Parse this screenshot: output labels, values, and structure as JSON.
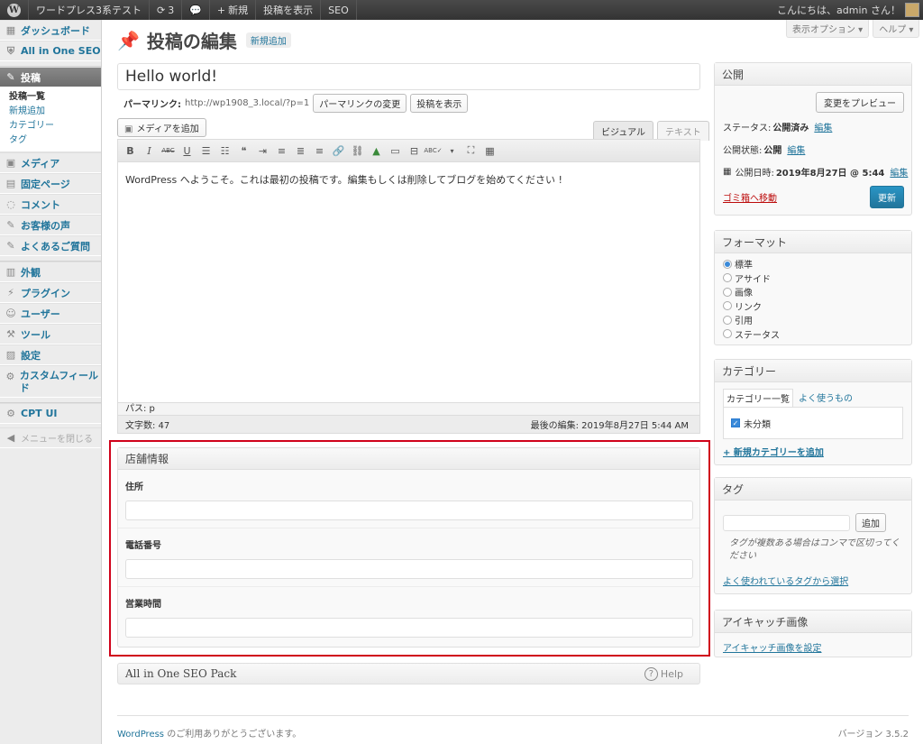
{
  "adminbar": {
    "site_name": "ワードプレス3系テスト",
    "updates_count": "3",
    "new_label": "新規",
    "view_post_label": "投稿を表示",
    "seo_label": "SEO",
    "greeting": "こんにちは、admin さん！"
  },
  "sidebar": {
    "items": [
      {
        "label": "ダッシュボード",
        "icon": "dashboard-icon"
      },
      {
        "label": "All in One SEO",
        "icon": "shield-icon"
      },
      {
        "label": "投稿",
        "icon": "pin-icon"
      },
      {
        "label": "メディア",
        "icon": "media-icon"
      },
      {
        "label": "固定ページ",
        "icon": "page-icon"
      },
      {
        "label": "コメント",
        "icon": "comment-icon"
      },
      {
        "label": "お客様の声",
        "icon": "pin-icon"
      },
      {
        "label": "よくあるご質問",
        "icon": "pin-icon"
      },
      {
        "label": "外観",
        "icon": "appearance-icon"
      },
      {
        "label": "プラグイン",
        "icon": "plugin-icon"
      },
      {
        "label": "ユーザー",
        "icon": "users-icon"
      },
      {
        "label": "ツール",
        "icon": "tools-icon"
      },
      {
        "label": "設定",
        "icon": "settings-icon"
      },
      {
        "label": "カスタムフィールド",
        "icon": "gear-icon"
      },
      {
        "label": "CPT UI",
        "icon": "gear-icon"
      },
      {
        "label": "メニューを閉じる",
        "icon": "collapse-icon"
      }
    ],
    "submenu": [
      "投稿一覧",
      "新規追加",
      "カテゴリー",
      "タグ"
    ]
  },
  "header": {
    "title": "投稿の編集",
    "add_new": "新規追加",
    "screen_options": "表示オプション ▾",
    "help": "ヘルプ ▾"
  },
  "post": {
    "title": "Hello world!",
    "permalink_label": "パーマリンク:",
    "permalink_url": "http://wp1908_3.local/?p=1",
    "change_permalink": "パーマリンクの変更",
    "view_post": "投稿を表示"
  },
  "editor": {
    "add_media": "メディアを追加",
    "tab_visual": "ビジュアル",
    "tab_text": "テキスト",
    "content": "WordPress へようこそ。これは最初の投稿です。編集もしくは削除してブログを始めてください !",
    "path": "パス: p",
    "word_count": "文字数: 47",
    "last_edited": "最後の編集: 2019年8月27日 5:44 AM"
  },
  "custom_fields": {
    "title": "店舗情報",
    "fields": [
      {
        "label": "住所",
        "value": ""
      },
      {
        "label": "電話番号",
        "value": ""
      },
      {
        "label": "営業時間",
        "value": ""
      }
    ]
  },
  "seo_box": {
    "title": "All in One SEO Pack",
    "help": "Help"
  },
  "publish": {
    "title": "公開",
    "preview": "変更をプレビュー",
    "status_label": "ステータス:",
    "status_value": "公開済み",
    "visibility_label": "公開状態:",
    "visibility_value": "公開",
    "date_label": "公開日時:",
    "date_value": "2019年8月27日 @ 5:44",
    "edit": "編集",
    "trash": "ゴミ箱へ移動",
    "update": "更新"
  },
  "format": {
    "title": "フォーマット",
    "options": [
      "標準",
      "アサイド",
      "画像",
      "リンク",
      "引用",
      "ステータス"
    ],
    "selected": 0
  },
  "category": {
    "title": "カテゴリー",
    "tab_all": "カテゴリー一覧",
    "tab_popular": "よく使うもの",
    "item": "未分類",
    "add_new": "+ 新規カテゴリーを追加"
  },
  "tags": {
    "title": "タグ",
    "add": "追加",
    "hint": "タグが複数ある場合はコンマで区切ってください",
    "choose": "よく使われているタグから選択"
  },
  "featured": {
    "title": "アイキャッチ画像",
    "set": "アイキャッチ画像を設定"
  },
  "footer": {
    "thanks_link": "WordPress",
    "thanks_text": " のご利用ありがとうございます。",
    "version": "バージョン 3.5.2"
  }
}
